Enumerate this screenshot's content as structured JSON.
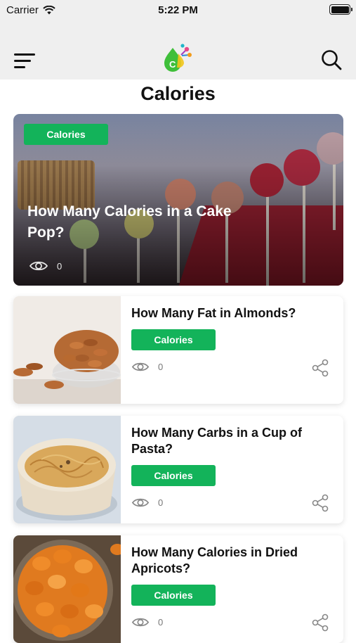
{
  "status_bar": {
    "carrier": "Carrier",
    "time": "5:22 PM"
  },
  "nav": {
    "menu_icon": "hamburger-menu-icon",
    "logo_icon": "calorie-app-logo-icon",
    "logo_letter": "C",
    "search_icon": "search-icon"
  },
  "page": {
    "title": "Calories"
  },
  "featured": {
    "category": "Calories",
    "title": "How Many Calories in a Cake Pop?",
    "views": "0"
  },
  "articles": [
    {
      "title": "How Many Fat in Almonds?",
      "category": "Calories",
      "views": "0"
    },
    {
      "title": "How Many Carbs in a Cup of Pasta?",
      "category": "Calories",
      "views": "0"
    },
    {
      "title": "How Many Calories in Dried Apricots?",
      "category": "Calories",
      "views": "0"
    }
  ],
  "colors": {
    "accent": "#13b35a",
    "header_bg": "#efefef"
  }
}
